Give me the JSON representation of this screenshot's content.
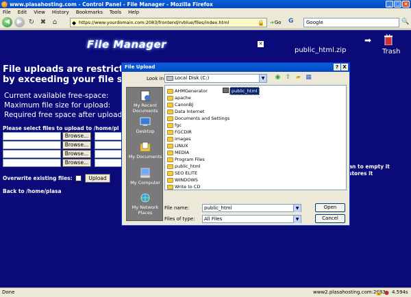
{
  "browser": {
    "title": "www.plasahosting.com - Control Panel - File Manager - Mozilla Firefox",
    "menu": [
      "File",
      "Edit",
      "View",
      "History",
      "Bookmarks",
      "Tools",
      "Help"
    ],
    "url": "https://www.yourdomain.com:2083/frontend/rvblue/files/index.html",
    "go_label": "Go",
    "search_value": "Google"
  },
  "page": {
    "title": "File Manager",
    "close_glyph": "✕",
    "zip_label": "public_html.zip",
    "trash_label": "Trash",
    "heading1": "File uploads are restricted",
    "heading2": "by exceeding your file sys",
    "free_space": "Current available free-space:",
    "max_size": "Maximum file size for upload:",
    "required": "Required free space after upload:",
    "select_files": "Please select files to upload to /home/pl",
    "browse_label": "Browse...",
    "overwrite": "Overwrite existing files:",
    "upload_label": "Upload",
    "back_link": "Back to /home/plasa",
    "empty_note1": "an to empty it",
    "empty_note2": "stores it"
  },
  "dialog": {
    "title": "File Upload",
    "help_glyph": "?",
    "close_glyph": "X",
    "look_in_label": "Look in:",
    "look_in_value": "Local Disk (C:)",
    "places": [
      "My Recent Documents",
      "Desktop",
      "My Documents",
      "My Computer",
      "My Network Places"
    ],
    "folders": [
      "AHMGenerator",
      "apache",
      "CanonBJ",
      "Data Internet",
      "Documents and Settings",
      "fgc",
      "FGCDIR",
      "images",
      "LINUX",
      "MEDIA",
      "Program Files",
      "public_html",
      "SEO ELITE",
      "WINDOWS",
      "Write to CD"
    ],
    "drag_item": "public_html",
    "file_name_label": "File name:",
    "file_name_value": "public_html",
    "file_type_label": "Files of type:",
    "file_type_value": "All Files",
    "open_label": "Open",
    "cancel_label": "Cancel"
  },
  "status": {
    "done": "Done",
    "host": "www2.plasahosting.com:2083",
    "time": "4.594s"
  }
}
